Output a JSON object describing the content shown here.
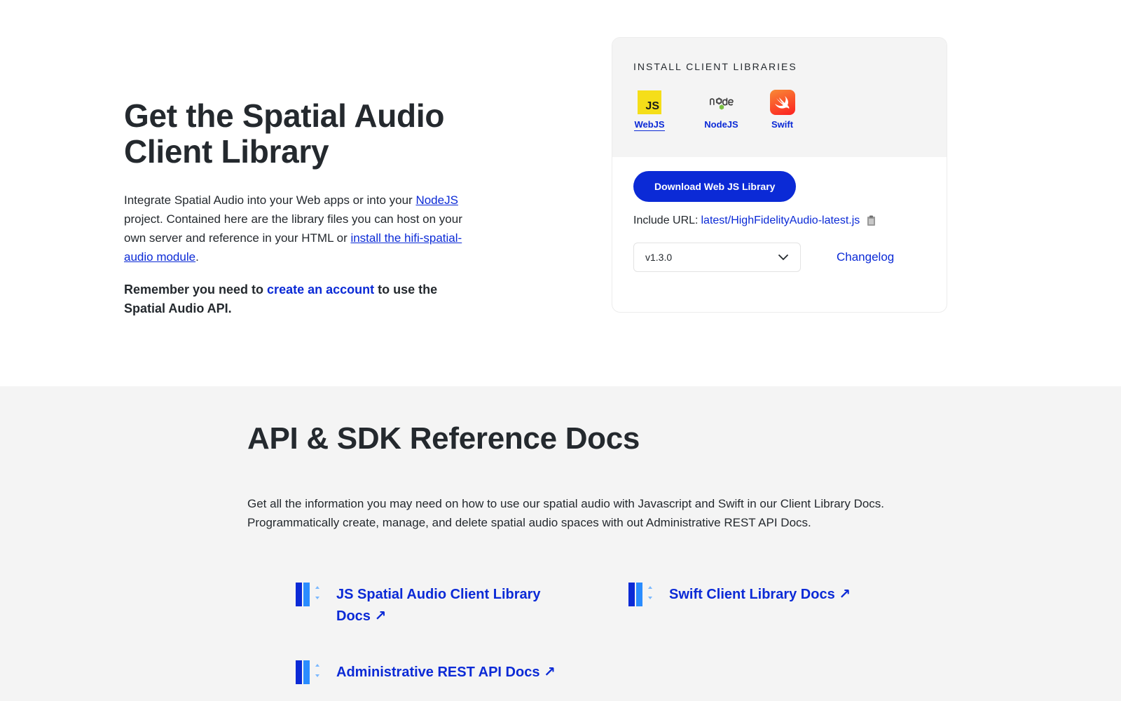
{
  "hero": {
    "title": "Get the Spatial Audio Client Library",
    "desc_part1": "Integrate Spatial Audio into your Web apps or into your ",
    "desc_link1": "NodeJS",
    "desc_part2": " project. Contained here are the library files you can host on your own server and reference in your HTML or ",
    "desc_link2": "install the hifi-spatial-audio module",
    "desc_part3": ".",
    "note_part1": "Remember you need to ",
    "note_link": "create an account",
    "note_part2": " to use the Spatial Audio API."
  },
  "install": {
    "heading": "INSTALL CLIENT LIBRARIES",
    "tabs": [
      {
        "label": "WebJS",
        "icon": "js-icon",
        "active": true
      },
      {
        "label": "NodeJS",
        "icon": "nodejs-icon",
        "active": false
      },
      {
        "label": "Swift",
        "icon": "swift-icon",
        "active": false
      }
    ],
    "js_badge": "JS",
    "download_label": "Download Web JS Library",
    "include_label": "Include URL:",
    "include_url": "latest/HighFidelityAudio-latest.js",
    "version_selected": "v1.3.0",
    "changelog_label": "Changelog"
  },
  "docs": {
    "title": "API & SDK Reference Docs",
    "description": "Get all the information you may need on how to use our spatial audio with Javascript and Swift in our Client Library Docs. Programmatically create, manage, and delete spatial audio spaces with out Administrative REST API Docs.",
    "links": [
      {
        "label_line1": "JS Spatial Audio Client Library",
        "label_line2": "Docs"
      },
      {
        "label_line1": "Swift Client Library Docs"
      },
      {
        "label_line1": "Administrative REST API Docs"
      }
    ],
    "arrow": "↗"
  },
  "colors": {
    "accent": "#0b2ad6",
    "text": "#24292e",
    "panel_bg": "#f4f4f4"
  }
}
